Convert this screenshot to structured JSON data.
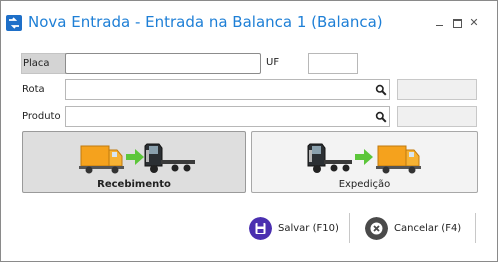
{
  "window": {
    "title": "Nova Entrada - Entrada na Balanca 1 (Balanca)",
    "minimize_icon": "minimize-icon",
    "maximize_icon": "maximize-icon",
    "close_glyph": "✕"
  },
  "form": {
    "placa": {
      "label": "Placa",
      "value": ""
    },
    "uf": {
      "label": "UF",
      "value": ""
    },
    "rota": {
      "label": "Rota",
      "value": "",
      "code": ""
    },
    "produto": {
      "label": "Produto",
      "value": "",
      "code": ""
    }
  },
  "operations": {
    "recebimento": {
      "label": "Recebimento",
      "icon": "truck-receive-icon",
      "selected": true
    },
    "expedicao": {
      "label": "Expedição",
      "icon": "truck-dispatch-icon",
      "selected": false
    }
  },
  "footer": {
    "save_label": "Salvar (F10)",
    "cancel_label": "Cancelar (F4)"
  },
  "colors": {
    "title": "#1e7fd6",
    "save_icon": "#4a2fb0",
    "cancel_icon": "#4a4a4a",
    "truck_orange": "#f5a21d",
    "arrow_green": "#5cc63a"
  }
}
